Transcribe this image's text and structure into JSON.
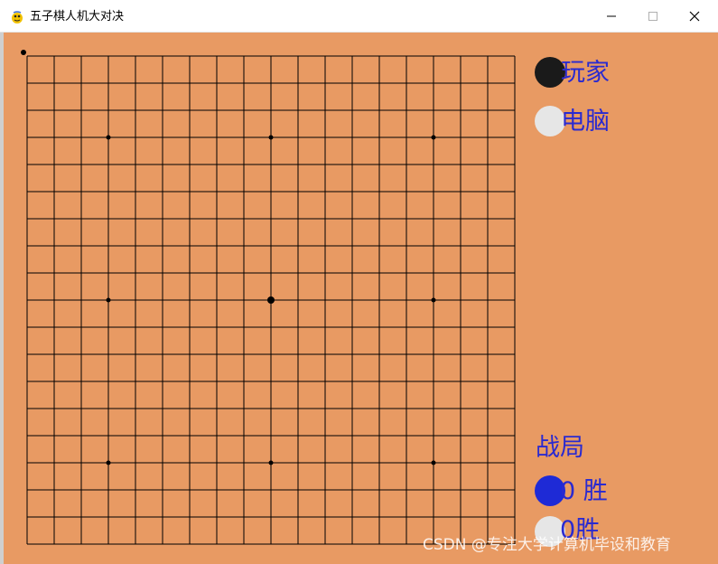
{
  "window": {
    "title": "五子棋人机大对决",
    "minimize_icon": "minimize-icon",
    "maximize_icon": "maximize-icon",
    "close_icon": "close-icon"
  },
  "colors": {
    "board_bg": "#e89a63",
    "grid_line": "#000000",
    "black_stone": "#1a1a1a",
    "white_stone": "#e6e6e6",
    "blue_stone": "#1e2ad6",
    "text_blue": "#2a2ad0"
  },
  "board": {
    "lines": 19,
    "star_points": [
      [
        3,
        3
      ],
      [
        9,
        3
      ],
      [
        15,
        3
      ],
      [
        3,
        9
      ],
      [
        9,
        9
      ],
      [
        15,
        9
      ],
      [
        3,
        15
      ],
      [
        9,
        15
      ],
      [
        15,
        15
      ]
    ],
    "center_point": [
      9,
      9
    ],
    "stones": []
  },
  "sidebar": {
    "player_label": "玩家",
    "computer_label": "电脑",
    "record_label": "战局",
    "player_score": "0  胜",
    "computer_score": "0胜"
  },
  "watermark": "CSDN @专注大学计算机毕设和教育"
}
